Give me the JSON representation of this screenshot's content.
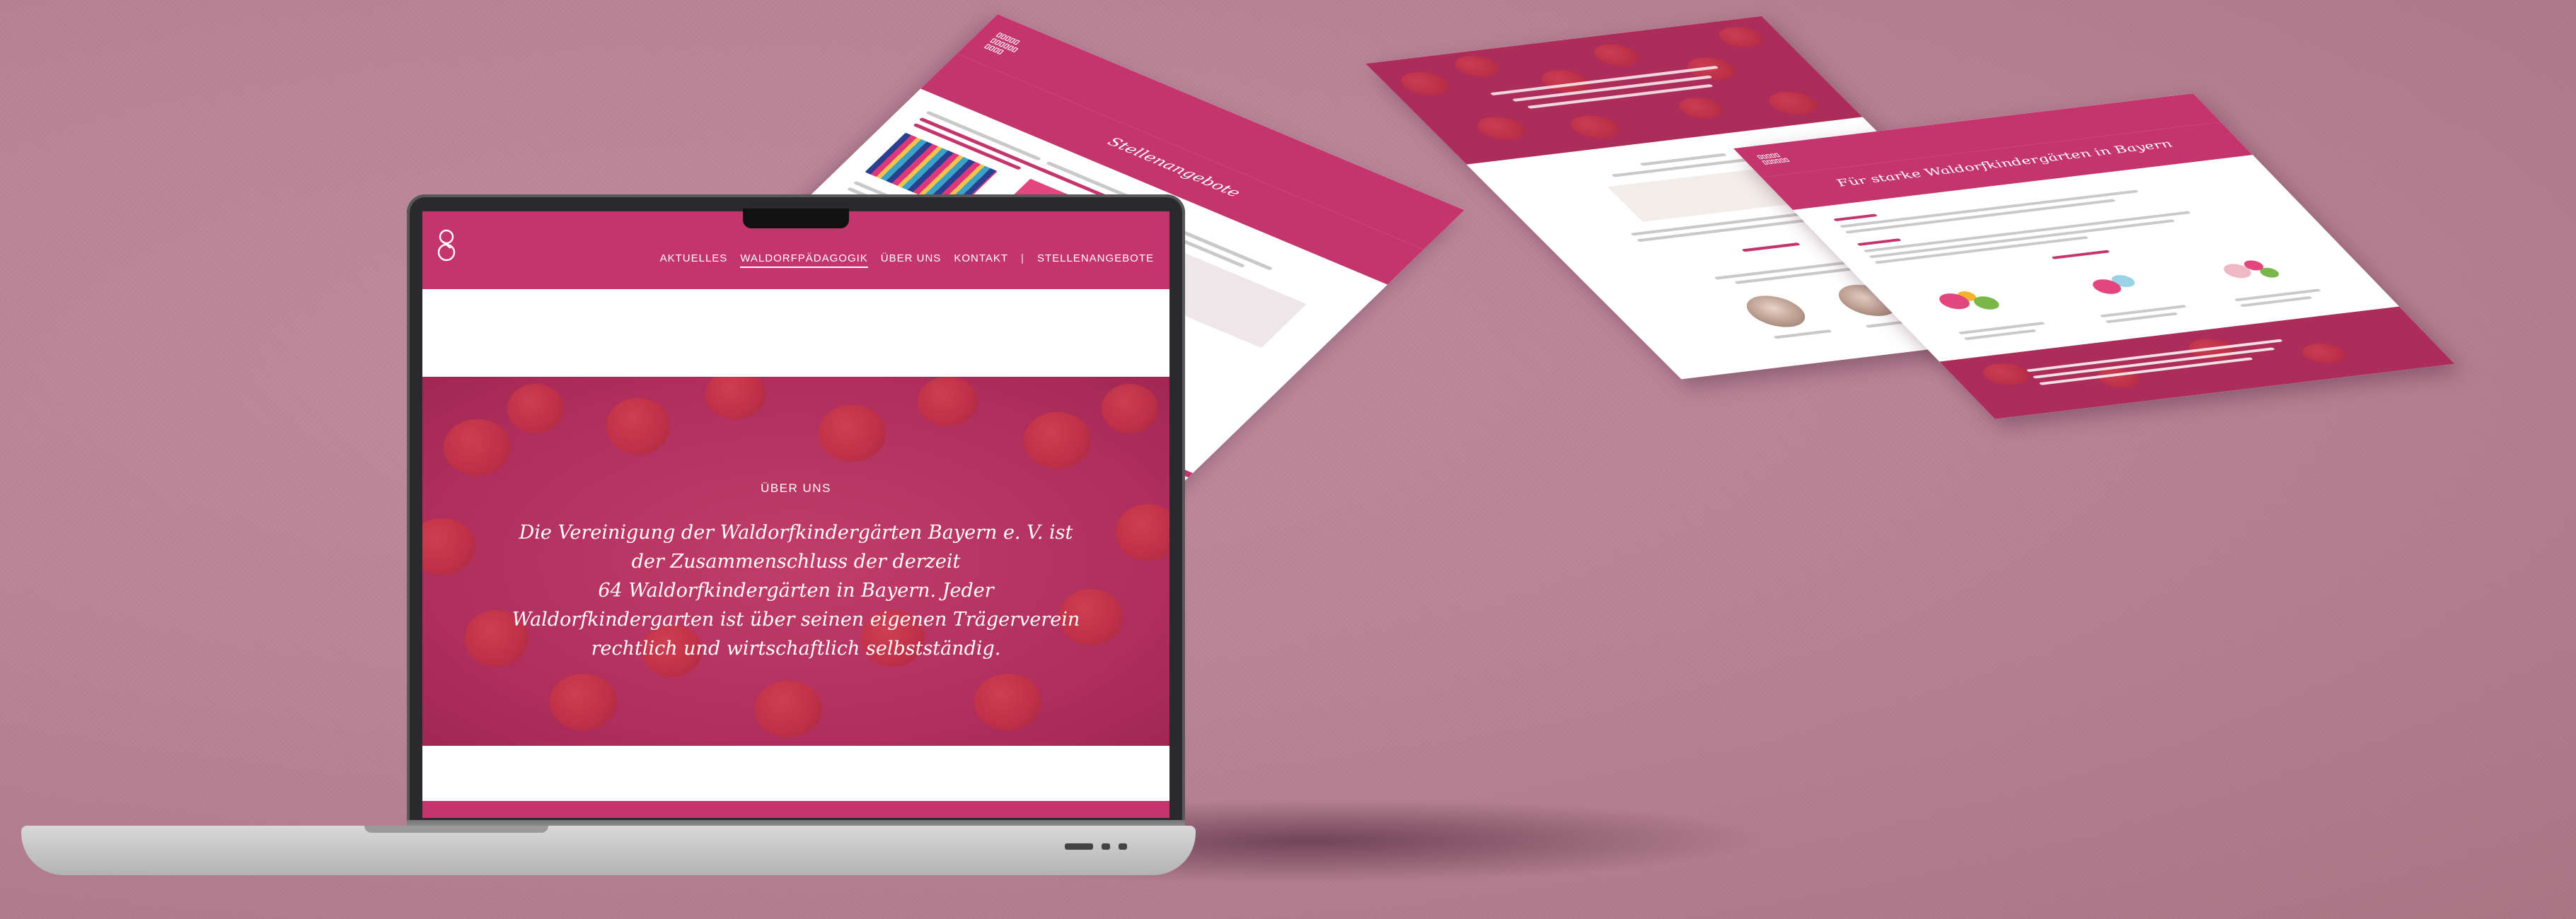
{
  "laptop_site": {
    "nav": {
      "items": [
        "AKTUELLES",
        "WALDORFPÄDAGOGIK",
        "ÜBER UNS",
        "KONTAKT",
        "|",
        "STELLENANGEBOTE"
      ],
      "active_index": 1
    },
    "hero": {
      "label": "ÜBER UNS",
      "text_lines": [
        "Die Vereinigung der Waldorfkindergärten Bayern e. V. ist",
        "der Zusammenschluss der derzeit",
        "64 Waldorfkindergärten in Bayern. Jeder",
        "Waldorfkindergarten ist über seinen eigenen Trägerverein",
        "rechtlich und wirtschaftlich selbstständig."
      ]
    }
  },
  "floating_pages": {
    "page1_title": "Stellenangebote",
    "page3_title": "Für starke Waldorfkindergärten in Bayern"
  },
  "colors": {
    "brand_pink": "#c3356c",
    "background": "#b78496"
  },
  "icons": [
    "waldorf-logo-icon"
  ]
}
